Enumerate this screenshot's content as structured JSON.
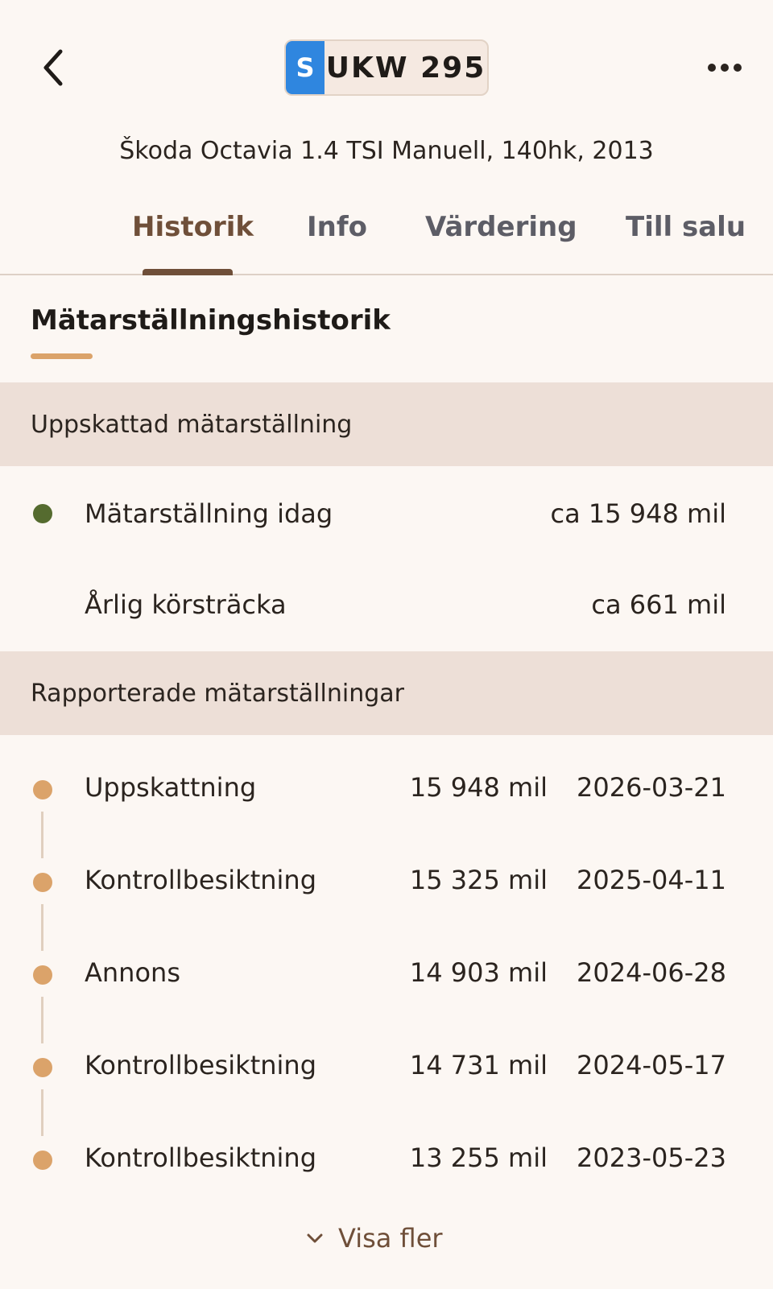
{
  "header": {
    "plate_country": "S",
    "plate_number": "UKW 295",
    "vehicle_description": "Škoda Octavia 1.4 TSI Manuell, 140hk, 2013",
    "back_icon": "chevron-left-icon",
    "more_icon": "more-horizontal-icon"
  },
  "tabs": [
    {
      "label": "Historik",
      "active": true
    },
    {
      "label": "Info",
      "active": false
    },
    {
      "label": "Värdering",
      "active": false
    },
    {
      "label": "Till salu",
      "active": false
    }
  ],
  "section": {
    "title": "Mätarställningshistorik"
  },
  "estimated": {
    "header": "Uppskattad mätarställning",
    "rows": [
      {
        "label": "Mätarställning idag",
        "value": "ca 15 948 mil"
      },
      {
        "label": "Årlig körsträcka",
        "value": "ca 661 mil"
      }
    ]
  },
  "reported": {
    "header": "Rapporterade mätarställningar",
    "rows": [
      {
        "label": "Uppskattning",
        "mileage": "15 948 mil",
        "date": "2026-03-21"
      },
      {
        "label": "Kontrollbesiktning",
        "mileage": "15 325 mil",
        "date": "2025-04-11"
      },
      {
        "label": "Annons",
        "mileage": "14 903 mil",
        "date": "2024-06-28"
      },
      {
        "label": "Kontrollbesiktning",
        "mileage": "14 731 mil",
        "date": "2024-05-17"
      },
      {
        "label": "Kontrollbesiktning",
        "mileage": "13 255 mil",
        "date": "2023-05-23"
      }
    ]
  },
  "show_more": {
    "label": "Visa fler",
    "icon": "chevron-down-icon"
  },
  "colors": {
    "background": "#fcf7f3",
    "band": "#eddfd7",
    "accent_brown": "#6f4f39",
    "accent_orange": "#dba36a",
    "status_green": "#556b2f",
    "plate_blue": "#2f86df"
  }
}
